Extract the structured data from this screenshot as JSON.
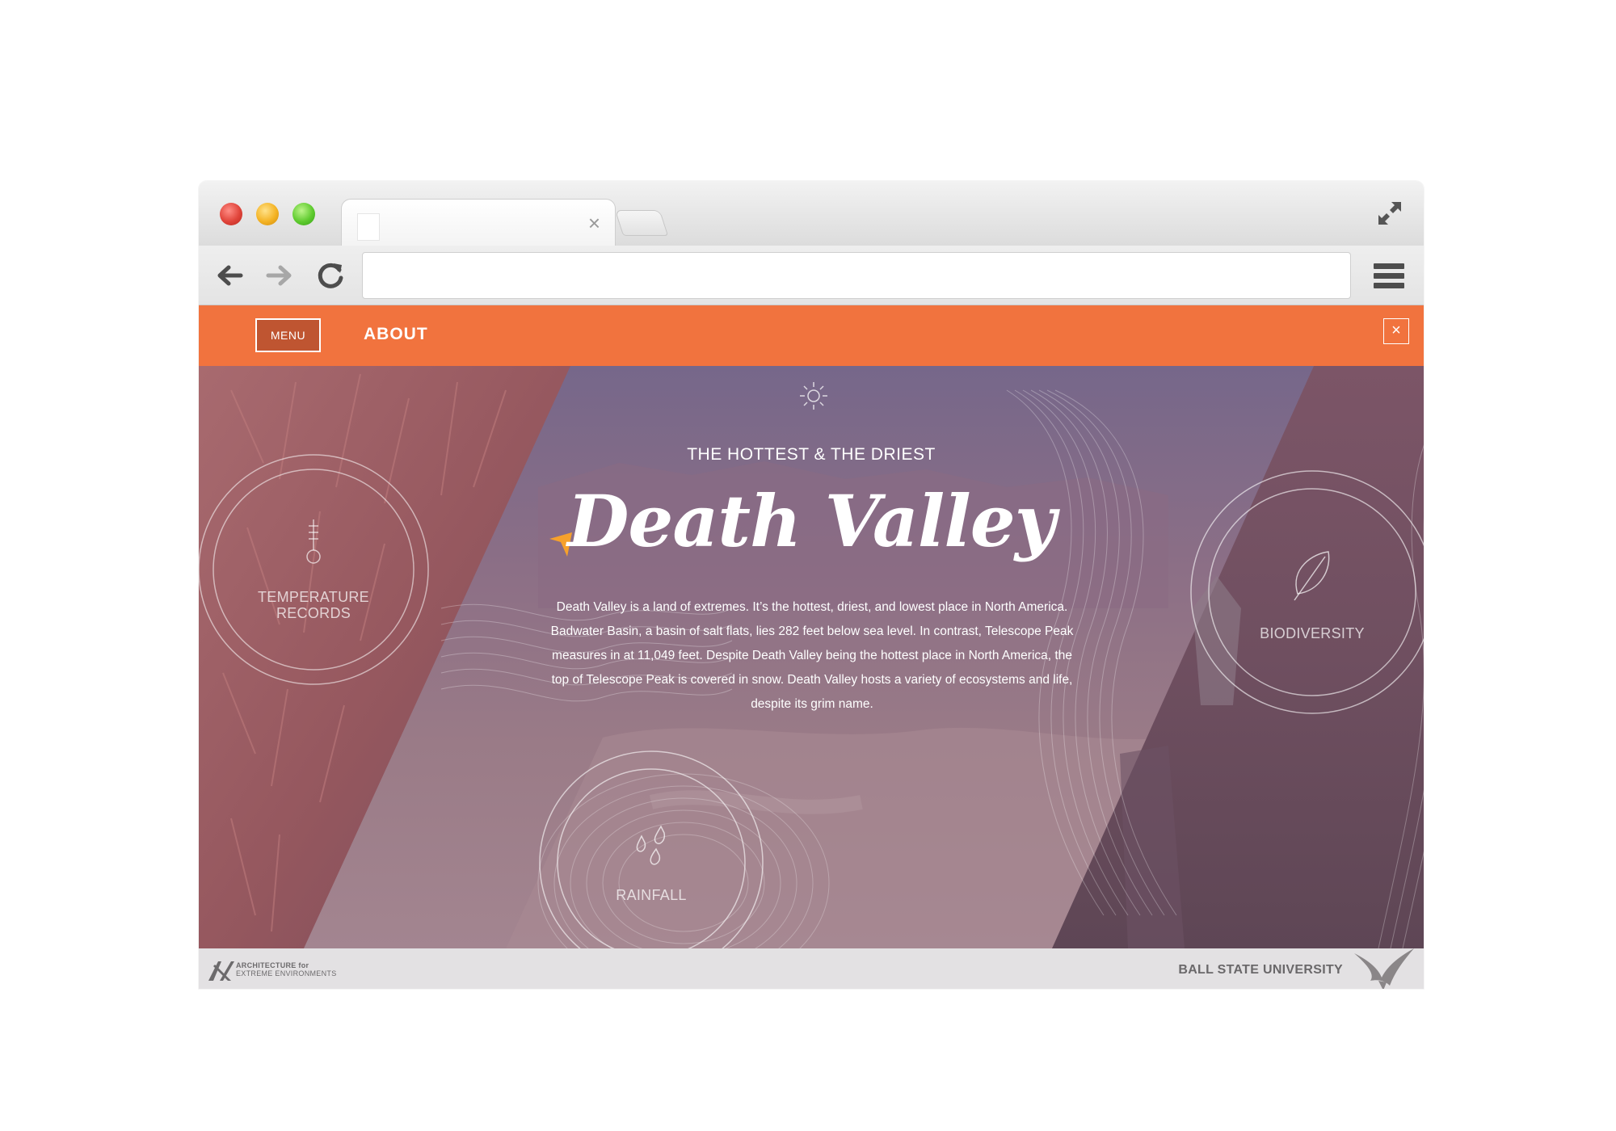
{
  "browser": {
    "tab": {
      "title": "",
      "close_glyph": "×"
    },
    "address_bar": {
      "value": ""
    },
    "icons": [
      "back-icon",
      "forward-icon",
      "reload-icon",
      "menu-icon",
      "expand-icon",
      "close-icon"
    ]
  },
  "site_nav": {
    "menu_label": "MENU",
    "about_label": "ABOUT",
    "close_glyph": "×",
    "accent_color": "#f1733e"
  },
  "hero": {
    "eyebrow": "THE HOTTEST & THE DRIEST",
    "title": "Death Valley",
    "description": "Death Valley is a land of extremes. It’s the hottest, driest, and lowest place in North America. Badwater Basin, a basin of salt flats, lies 282 feet below sea level. In contrast, Telescope Peak measures in at 11,049 feet. Despite Death Valley being the hottest place in North America, the top of Telescope Peak is covered in snow. Death Valley hosts a variety of ecosystems and life, despite its grim name.",
    "circles": {
      "temperature": "TEMPERATURE\nRECORDS",
      "biodiversity": "BIODIVERSITY",
      "rainfall": "RAINFALL"
    }
  },
  "footer": {
    "logo_line1": "ARCHITECTURE for",
    "logo_line2": "EXTREME ENVIRONMENTS",
    "university": "BALL STATE UNIVERSITY"
  }
}
